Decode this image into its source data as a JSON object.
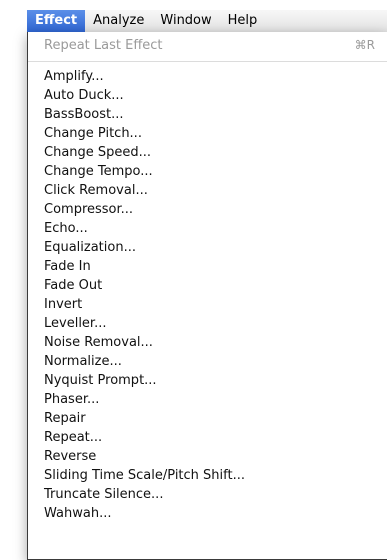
{
  "menubar": {
    "items": [
      "Effect",
      "Analyze",
      "Window",
      "Help"
    ]
  },
  "menu": {
    "repeat_label": "Repeat Last Effect",
    "repeat_shortcut": "⌘R",
    "items": [
      "Amplify...",
      "Auto Duck...",
      "BassBoost...",
      "Change Pitch...",
      "Change Speed...",
      "Change Tempo...",
      "Click Removal...",
      "Compressor...",
      "Echo...",
      "Equalization...",
      "Fade In",
      "Fade Out",
      "Invert",
      "Leveller...",
      "Noise Removal...",
      "Normalize...",
      "Nyquist Prompt...",
      "Phaser...",
      "Repair",
      "Repeat...",
      "Reverse",
      "Sliding Time Scale/Pitch Shift...",
      "Truncate Silence...",
      "Wahwah..."
    ]
  },
  "colors": {
    "active_menu_bg": "#2f66d3",
    "disabled_text": "#9a9a9a"
  }
}
